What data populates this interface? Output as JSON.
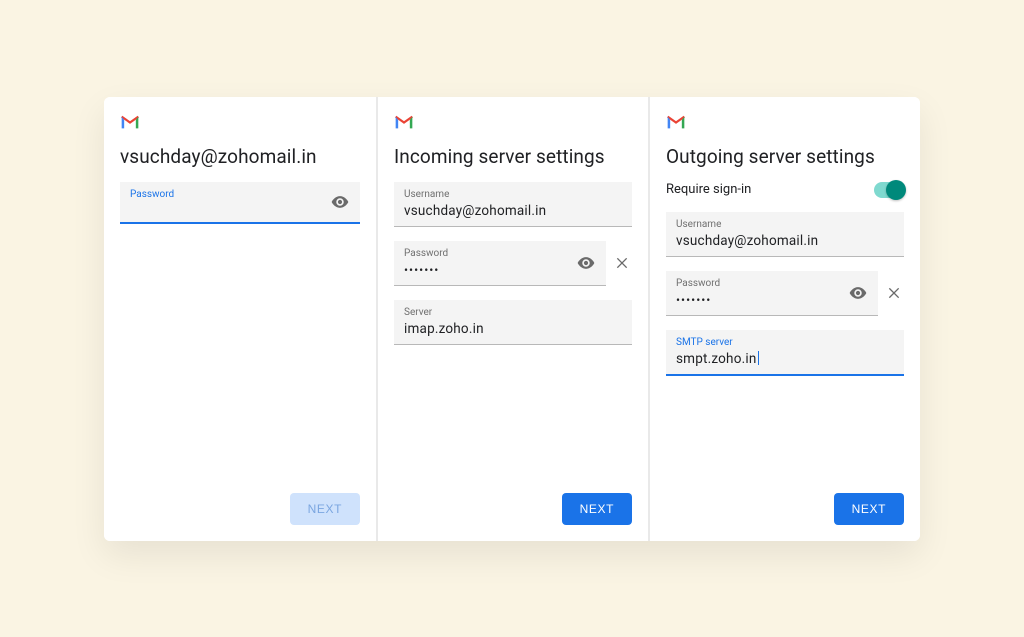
{
  "panel1": {
    "title": "vsuchday@zohomail.in",
    "password_label": "Password",
    "password_value": "",
    "next_label": "NEXT"
  },
  "panel2": {
    "title": "Incoming server settings",
    "username_label": "Username",
    "username_value": "vsuchday@zohomail.in",
    "password_label": "Password",
    "password_value": "•••••••",
    "server_label": "Server",
    "server_value": "imap.zoho.in",
    "next_label": "NEXT"
  },
  "panel3": {
    "title": "Outgoing server settings",
    "require_signin_label": "Require sign-in",
    "require_signin_on": true,
    "username_label": "Username",
    "username_value": "vsuchday@zohomail.in",
    "password_label": "Password",
    "password_value": "•••••••",
    "smtp_label": "SMTP server",
    "smtp_value": "smpt.zoho.in",
    "next_label": "NEXT"
  },
  "colors": {
    "accent": "#1a73e8",
    "toggle": "#00897b"
  }
}
